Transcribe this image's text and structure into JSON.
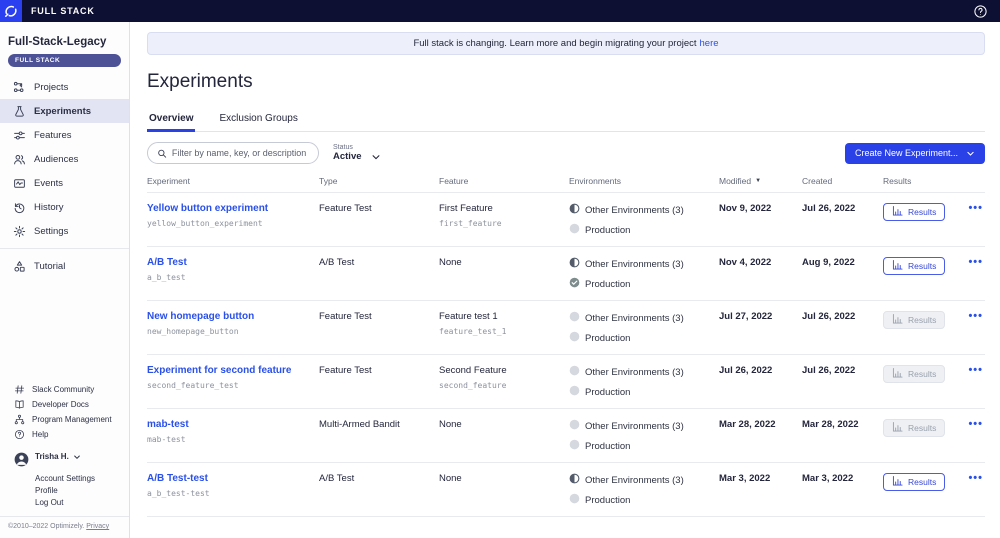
{
  "topbar": {
    "brand": "FULL STACK"
  },
  "sidebar": {
    "project_name": "Full-Stack-Legacy",
    "badge": "FULL STACK",
    "items": [
      {
        "label": "Projects",
        "icon": "projects-icon",
        "active": false
      },
      {
        "label": "Experiments",
        "icon": "flask-icon",
        "active": true
      },
      {
        "label": "Features",
        "icon": "sliders-icon",
        "active": false
      },
      {
        "label": "Audiences",
        "icon": "people-icon",
        "active": false
      },
      {
        "label": "Events",
        "icon": "events-icon",
        "active": false
      },
      {
        "label": "History",
        "icon": "history-icon",
        "active": false
      },
      {
        "label": "Settings",
        "icon": "gear-icon",
        "active": false
      },
      {
        "divider": true
      },
      {
        "label": "Tutorial",
        "icon": "shapes-icon",
        "active": false
      }
    ],
    "footer_links": [
      {
        "label": "Slack Community",
        "icon": "hash-icon"
      },
      {
        "label": "Developer Docs",
        "icon": "book-icon"
      },
      {
        "label": "Program Management",
        "icon": "sitemap-icon"
      },
      {
        "label": "Help",
        "icon": "help-icon"
      }
    ],
    "user": {
      "name": "Trisha H.",
      "links": [
        "Account Settings",
        "Profile",
        "Log Out"
      ]
    },
    "copyright": "©2010–2022 Optimizely.",
    "privacy_link": "Privacy"
  },
  "banner": {
    "text": "Full stack is changing. Learn more and begin migrating your project",
    "link": "here"
  },
  "page": {
    "title": "Experiments"
  },
  "tabs": [
    {
      "label": "Overview",
      "active": true
    },
    {
      "label": "Exclusion Groups",
      "active": false
    }
  ],
  "toolbar": {
    "filter_placeholder": "Filter by name, key, or description",
    "status_label": "Status",
    "status_value": "Active",
    "create_button": "Create New Experiment..."
  },
  "table": {
    "headers": [
      "Experiment",
      "Type",
      "Feature",
      "Environments",
      "Modified",
      "Created",
      "Results"
    ],
    "sorted_column": "Modified",
    "results_label": "Results",
    "rows": [
      {
        "name": "Yellow button experiment",
        "key": "yellow_button_experiment",
        "type": "Feature Test",
        "feature": "First Feature",
        "feature_key": "first_feature",
        "environments": [
          {
            "label": "Other Environments (3)",
            "state": "half"
          },
          {
            "label": "Production",
            "state": "off"
          }
        ],
        "modified": "Nov 9, 2022",
        "created": "Jul 26, 2022",
        "results_enabled": true
      },
      {
        "name": "A/B Test",
        "key": "a_b_test",
        "type": "A/B Test",
        "feature": "None",
        "feature_key": "",
        "environments": [
          {
            "label": "Other Environments (3)",
            "state": "half"
          },
          {
            "label": "Production",
            "state": "check"
          }
        ],
        "modified": "Nov 4, 2022",
        "created": "Aug 9, 2022",
        "results_enabled": true
      },
      {
        "name": "New homepage button",
        "key": "new_homepage_button",
        "type": "Feature Test",
        "feature": "Feature test 1",
        "feature_key": "feature_test_1",
        "environments": [
          {
            "label": "Other Environments (3)",
            "state": "off"
          },
          {
            "label": "Production",
            "state": "off"
          }
        ],
        "modified": "Jul 27, 2022",
        "created": "Jul 26, 2022",
        "results_enabled": false
      },
      {
        "name": "Experiment for second feature",
        "key": "second_feature_test",
        "type": "Feature Test",
        "feature": "Second Feature",
        "feature_key": "second_feature",
        "environments": [
          {
            "label": "Other Environments (3)",
            "state": "off"
          },
          {
            "label": "Production",
            "state": "off"
          }
        ],
        "modified": "Jul 26, 2022",
        "created": "Jul 26, 2022",
        "results_enabled": false
      },
      {
        "name": "mab-test",
        "key": "mab-test",
        "type": "Multi-Armed Bandit",
        "feature": "None",
        "feature_key": "",
        "environments": [
          {
            "label": "Other Environments (3)",
            "state": "off"
          },
          {
            "label": "Production",
            "state": "off"
          }
        ],
        "modified": "Mar 28, 2022",
        "created": "Mar 28, 2022",
        "results_enabled": false
      },
      {
        "name": "A/B Test-test",
        "key": "a_b_test-test",
        "type": "A/B Test",
        "feature": "None",
        "feature_key": "",
        "environments": [
          {
            "label": "Other Environments (3)",
            "state": "half"
          },
          {
            "label": "Production",
            "state": "off"
          }
        ],
        "modified": "Mar 3, 2022",
        "created": "Mar 3, 2022",
        "results_enabled": true
      }
    ]
  }
}
